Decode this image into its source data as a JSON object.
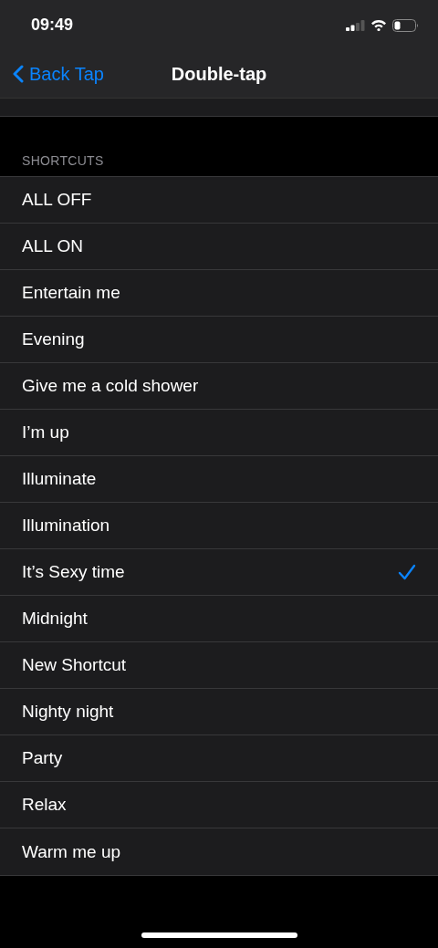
{
  "status_bar": {
    "time": "09:49"
  },
  "nav": {
    "back_label": "Back Tap",
    "title": "Double-tap"
  },
  "section": {
    "header": "SHORTCUTS",
    "items": [
      {
        "label": "ALL OFF",
        "selected": false
      },
      {
        "label": "ALL ON",
        "selected": false
      },
      {
        "label": "Entertain me",
        "selected": false
      },
      {
        "label": "Evening",
        "selected": false
      },
      {
        "label": "Give me a cold shower",
        "selected": false
      },
      {
        "label": "I’m up",
        "selected": false
      },
      {
        "label": "Illuminate",
        "selected": false
      },
      {
        "label": "Illumination",
        "selected": false
      },
      {
        "label": "It’s Sexy time",
        "selected": true
      },
      {
        "label": "Midnight",
        "selected": false
      },
      {
        "label": "New Shortcut",
        "selected": false
      },
      {
        "label": "Nighty night",
        "selected": false
      },
      {
        "label": "Party",
        "selected": false
      },
      {
        "label": "Relax",
        "selected": false
      },
      {
        "label": "Warm me up",
        "selected": false
      }
    ]
  }
}
